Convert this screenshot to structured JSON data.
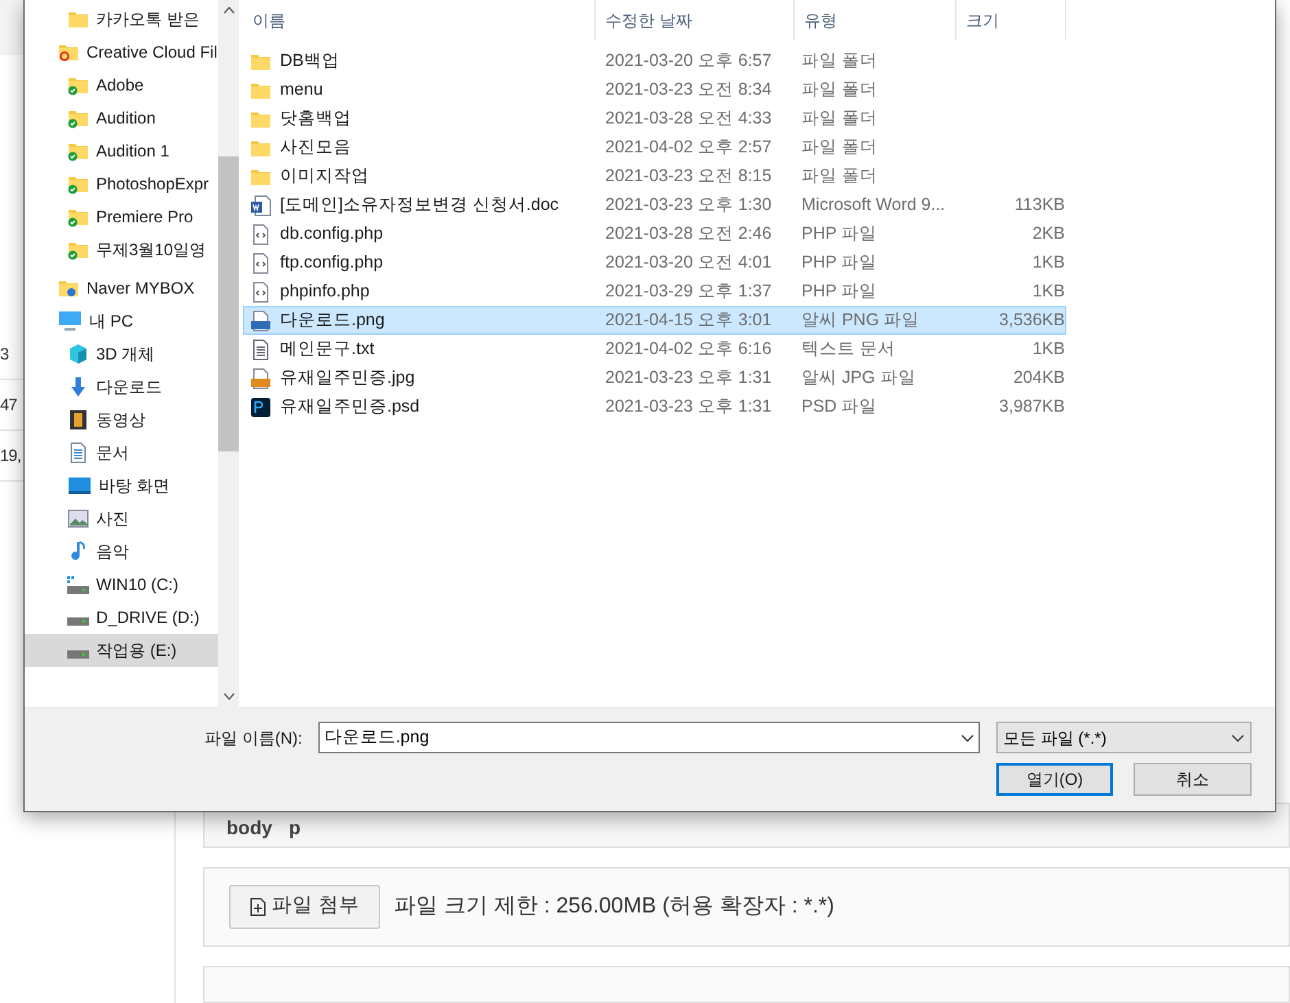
{
  "background": {
    "side_cells": [
      "3",
      "47",
      "19,"
    ],
    "breadcrumb": [
      "body",
      "p"
    ],
    "attach_button": "파일 첨부",
    "attach_note": "파일 크기 제한 : 256.00MB (허용 확장자 : *.*)"
  },
  "nav": {
    "items": [
      {
        "children": [
          {
            "label": "카카오톡 받은",
            "kind": "folder",
            "selected": false
          }
        ]
      },
      {
        "label": "Creative Cloud Fil",
        "kind": "cc-folder",
        "selected": false,
        "children": [
          {
            "label": "Adobe",
            "kind": "synced-folder",
            "selected": false
          },
          {
            "label": "Audition",
            "kind": "synced-folder",
            "selected": false
          },
          {
            "label": "Audition 1",
            "kind": "synced-folder",
            "selected": false
          },
          {
            "label": "PhotoshopExpr",
            "kind": "synced-folder",
            "selected": false
          },
          {
            "label": "Premiere Pro",
            "kind": "synced-folder",
            "selected": false
          },
          {
            "label": "무제3월10일영",
            "kind": "synced-folder",
            "selected": false
          }
        ]
      },
      {
        "label": "Naver MYBOX",
        "kind": "cloud-folder",
        "selected": false
      },
      {
        "label": "내 PC",
        "kind": "pc",
        "selected": false,
        "children": [
          {
            "label": "3D 개체",
            "kind": "cube",
            "selected": false
          },
          {
            "label": "다운로드",
            "kind": "download",
            "selected": false
          },
          {
            "label": "동영상",
            "kind": "film",
            "selected": false
          },
          {
            "label": "문서",
            "kind": "document",
            "selected": false
          },
          {
            "label": "바탕 화면",
            "kind": "desktop",
            "selected": false
          },
          {
            "label": "사진",
            "kind": "picture",
            "selected": false
          },
          {
            "label": "음악",
            "kind": "music",
            "selected": false
          },
          {
            "label": "WIN10 (C:)",
            "kind": "system-drive",
            "selected": false
          },
          {
            "label": "D_DRIVE (D:)",
            "kind": "drive",
            "selected": false
          },
          {
            "label": "작업용 (E:)",
            "kind": "drive",
            "selected": true
          }
        ]
      }
    ]
  },
  "table": {
    "columns": [
      "이름",
      "수정한 날짜",
      "유형",
      "크기"
    ],
    "rows": [
      {
        "kind": "folder",
        "name": "DB백업",
        "date": "2021-03-20 오후 6:57",
        "type": "파일 폴더",
        "selected": false
      },
      {
        "kind": "folder",
        "name": "menu",
        "date": "2021-03-23 오전 8:34",
        "type": "파일 폴더",
        "selected": false
      },
      {
        "kind": "folder",
        "name": "닷홈백업",
        "date": "2021-03-28 오전 4:33",
        "type": "파일 폴더",
        "selected": false
      },
      {
        "kind": "folder",
        "name": "사진모음",
        "date": "2021-04-02 오후 2:57",
        "type": "파일 폴더",
        "selected": false
      },
      {
        "kind": "folder",
        "name": "이미지작업",
        "date": "2021-03-23 오전 8:15",
        "type": "파일 폴더",
        "selected": false
      },
      {
        "kind": "word",
        "name": "[도메인]소유자정보변경 신청서.doc",
        "date": "2021-03-23 오후 1:30",
        "type": "Microsoft Word 9...",
        "size": "113KB",
        "selected": false
      },
      {
        "kind": "code",
        "name": "db.config.php",
        "date": "2021-03-28 오전 2:46",
        "type": "PHP 파일",
        "size": "2KB",
        "selected": false
      },
      {
        "kind": "code",
        "name": "ftp.config.php",
        "date": "2021-03-20 오전 4:01",
        "type": "PHP 파일",
        "size": "1KB",
        "selected": false
      },
      {
        "kind": "code",
        "name": "phpinfo.php",
        "date": "2021-03-29 오후 1:37",
        "type": "PHP 파일",
        "size": "1KB",
        "selected": false
      },
      {
        "kind": "png",
        "name": "다운로드.png",
        "date": "2021-04-15 오후 3:01",
        "type": "알씨 PNG 파일",
        "size": "3,536KB",
        "selected": true
      },
      {
        "kind": "text",
        "name": "메인문구.txt",
        "date": "2021-04-02 오후 6:16",
        "type": "텍스트 문서",
        "size": "1KB",
        "selected": false
      },
      {
        "kind": "jpg",
        "name": "유재일주민증.jpg",
        "date": "2021-03-23 오후 1:31",
        "type": "알씨 JPG 파일",
        "size": "204KB",
        "selected": false
      },
      {
        "kind": "psd",
        "name": "유재일주민증.psd",
        "date": "2021-03-23 오후 1:31",
        "type": "PSD 파일",
        "size": "3,987KB",
        "selected": false
      }
    ]
  },
  "filename": {
    "label": "파일 이름(N):",
    "value": "다운로드.png"
  },
  "filter": {
    "value": "모든 파일 (*.*)"
  },
  "buttons": [
    {
      "label": "열기(O)",
      "kind": "primary"
    },
    {
      "label": "취소",
      "kind": "secondary"
    }
  ]
}
